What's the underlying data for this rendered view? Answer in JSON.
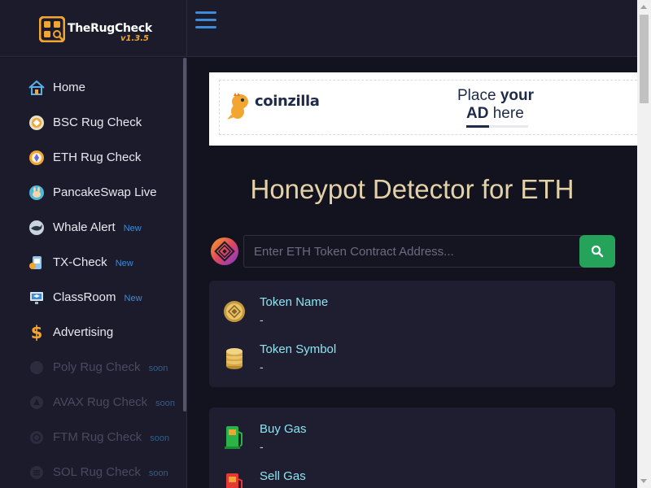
{
  "brand": {
    "name": "TheRugCheck",
    "version": "v1.3.5"
  },
  "sidebar": {
    "items": [
      {
        "label": "Home",
        "badge": "",
        "icon": "home-icon"
      },
      {
        "label": "BSC Rug Check",
        "badge": "",
        "icon": "bsc-coin-icon"
      },
      {
        "label": "ETH Rug Check",
        "badge": "",
        "icon": "eth-coin-icon"
      },
      {
        "label": "PancakeSwap Live",
        "badge": "",
        "icon": "pancakeswap-bunny-icon"
      },
      {
        "label": "Whale Alert",
        "badge": "New",
        "icon": "whale-icon"
      },
      {
        "label": "TX-Check",
        "badge": "New",
        "icon": "tx-check-icon"
      },
      {
        "label": "ClassRoom",
        "badge": "New",
        "icon": "classroom-icon"
      },
      {
        "label": "Advertising",
        "badge": "",
        "icon": "dollar-icon"
      },
      {
        "label": "Poly Rug Check",
        "badge": "soon",
        "icon": "polygon-coin-icon"
      },
      {
        "label": "AVAX Rug Check",
        "badge": "soon",
        "icon": "avax-coin-icon"
      },
      {
        "label": "FTM Rug Check",
        "badge": "soon",
        "icon": "fantom-coin-icon"
      },
      {
        "label": "SOL Rug Check",
        "badge": "soon",
        "icon": "solana-coin-icon"
      }
    ]
  },
  "ad": {
    "brand": "coinzilla",
    "line1_pre": "Place ",
    "line1_bold": "your",
    "line2_bold": "AD",
    "line2_post": " here"
  },
  "main": {
    "title": "Honeypot Detector for ETH",
    "search": {
      "placeholder": "Enter ETH Token Contract Address..."
    },
    "token_card": [
      {
        "label": "Token Name",
        "value": "-",
        "icon": "token-name-coin-icon"
      },
      {
        "label": "Token Symbol",
        "value": "-",
        "icon": "coin-stack-icon"
      }
    ],
    "gas_card": [
      {
        "label": "Buy Gas",
        "value": "-",
        "icon": "green-gas-pump-icon"
      },
      {
        "label": "Sell Gas",
        "value": "",
        "icon": "red-gas-pump-icon"
      }
    ]
  },
  "colors": {
    "background": "#13131f",
    "panel": "#1b1b2b",
    "card": "#1e1e30",
    "accent_blue": "#3d8bd9",
    "accent_orange": "#f2a531",
    "title_gold": "#e3d2a7",
    "label_cyan": "#8fe3f0",
    "search_green": "#25a35a"
  }
}
